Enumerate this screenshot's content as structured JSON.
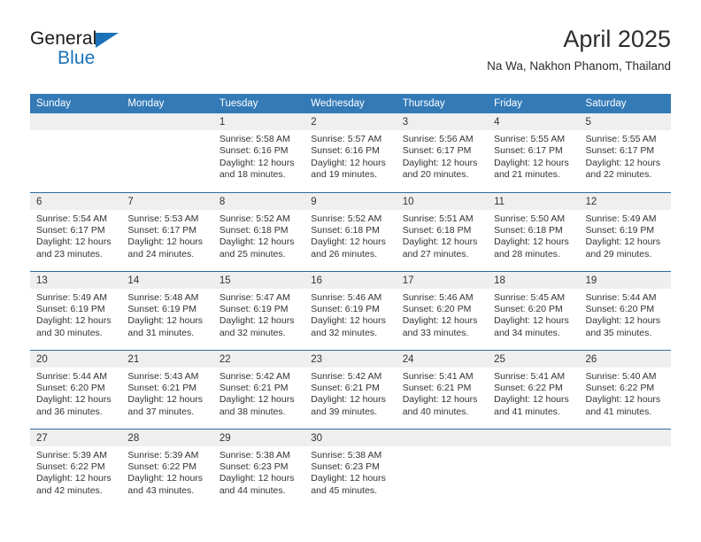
{
  "brand": {
    "name_top": "General",
    "name_bottom": "Blue",
    "accent_color": "#1b72b8"
  },
  "header": {
    "title": "April 2025",
    "subtitle": "Na Wa, Nakhon Phanom, Thailand"
  },
  "theme": {
    "header_blue": "#337ab7",
    "row_rule": "#2b6ca3",
    "daynum_band": "#efefef",
    "text": "#333333"
  },
  "calendar": {
    "weekday_headers": [
      "Sunday",
      "Monday",
      "Tuesday",
      "Wednesday",
      "Thursday",
      "Friday",
      "Saturday"
    ],
    "weeks": [
      [
        {
          "day": "",
          "sunrise": "",
          "sunset": "",
          "daylight_line1": "",
          "daylight_line2": ""
        },
        {
          "day": "",
          "sunrise": "",
          "sunset": "",
          "daylight_line1": "",
          "daylight_line2": ""
        },
        {
          "day": "1",
          "sunrise": "Sunrise: 5:58 AM",
          "sunset": "Sunset: 6:16 PM",
          "daylight_line1": "Daylight: 12 hours",
          "daylight_line2": "and 18 minutes."
        },
        {
          "day": "2",
          "sunrise": "Sunrise: 5:57 AM",
          "sunset": "Sunset: 6:16 PM",
          "daylight_line1": "Daylight: 12 hours",
          "daylight_line2": "and 19 minutes."
        },
        {
          "day": "3",
          "sunrise": "Sunrise: 5:56 AM",
          "sunset": "Sunset: 6:17 PM",
          "daylight_line1": "Daylight: 12 hours",
          "daylight_line2": "and 20 minutes."
        },
        {
          "day": "4",
          "sunrise": "Sunrise: 5:55 AM",
          "sunset": "Sunset: 6:17 PM",
          "daylight_line1": "Daylight: 12 hours",
          "daylight_line2": "and 21 minutes."
        },
        {
          "day": "5",
          "sunrise": "Sunrise: 5:55 AM",
          "sunset": "Sunset: 6:17 PM",
          "daylight_line1": "Daylight: 12 hours",
          "daylight_line2": "and 22 minutes."
        }
      ],
      [
        {
          "day": "6",
          "sunrise": "Sunrise: 5:54 AM",
          "sunset": "Sunset: 6:17 PM",
          "daylight_line1": "Daylight: 12 hours",
          "daylight_line2": "and 23 minutes."
        },
        {
          "day": "7",
          "sunrise": "Sunrise: 5:53 AM",
          "sunset": "Sunset: 6:17 PM",
          "daylight_line1": "Daylight: 12 hours",
          "daylight_line2": "and 24 minutes."
        },
        {
          "day": "8",
          "sunrise": "Sunrise: 5:52 AM",
          "sunset": "Sunset: 6:18 PM",
          "daylight_line1": "Daylight: 12 hours",
          "daylight_line2": "and 25 minutes."
        },
        {
          "day": "9",
          "sunrise": "Sunrise: 5:52 AM",
          "sunset": "Sunset: 6:18 PM",
          "daylight_line1": "Daylight: 12 hours",
          "daylight_line2": "and 26 minutes."
        },
        {
          "day": "10",
          "sunrise": "Sunrise: 5:51 AM",
          "sunset": "Sunset: 6:18 PM",
          "daylight_line1": "Daylight: 12 hours",
          "daylight_line2": "and 27 minutes."
        },
        {
          "day": "11",
          "sunrise": "Sunrise: 5:50 AM",
          "sunset": "Sunset: 6:18 PM",
          "daylight_line1": "Daylight: 12 hours",
          "daylight_line2": "and 28 minutes."
        },
        {
          "day": "12",
          "sunrise": "Sunrise: 5:49 AM",
          "sunset": "Sunset: 6:19 PM",
          "daylight_line1": "Daylight: 12 hours",
          "daylight_line2": "and 29 minutes."
        }
      ],
      [
        {
          "day": "13",
          "sunrise": "Sunrise: 5:49 AM",
          "sunset": "Sunset: 6:19 PM",
          "daylight_line1": "Daylight: 12 hours",
          "daylight_line2": "and 30 minutes."
        },
        {
          "day": "14",
          "sunrise": "Sunrise: 5:48 AM",
          "sunset": "Sunset: 6:19 PM",
          "daylight_line1": "Daylight: 12 hours",
          "daylight_line2": "and 31 minutes."
        },
        {
          "day": "15",
          "sunrise": "Sunrise: 5:47 AM",
          "sunset": "Sunset: 6:19 PM",
          "daylight_line1": "Daylight: 12 hours",
          "daylight_line2": "and 32 minutes."
        },
        {
          "day": "16",
          "sunrise": "Sunrise: 5:46 AM",
          "sunset": "Sunset: 6:19 PM",
          "daylight_line1": "Daylight: 12 hours",
          "daylight_line2": "and 32 minutes."
        },
        {
          "day": "17",
          "sunrise": "Sunrise: 5:46 AM",
          "sunset": "Sunset: 6:20 PM",
          "daylight_line1": "Daylight: 12 hours",
          "daylight_line2": "and 33 minutes."
        },
        {
          "day": "18",
          "sunrise": "Sunrise: 5:45 AM",
          "sunset": "Sunset: 6:20 PM",
          "daylight_line1": "Daylight: 12 hours",
          "daylight_line2": "and 34 minutes."
        },
        {
          "day": "19",
          "sunrise": "Sunrise: 5:44 AM",
          "sunset": "Sunset: 6:20 PM",
          "daylight_line1": "Daylight: 12 hours",
          "daylight_line2": "and 35 minutes."
        }
      ],
      [
        {
          "day": "20",
          "sunrise": "Sunrise: 5:44 AM",
          "sunset": "Sunset: 6:20 PM",
          "daylight_line1": "Daylight: 12 hours",
          "daylight_line2": "and 36 minutes."
        },
        {
          "day": "21",
          "sunrise": "Sunrise: 5:43 AM",
          "sunset": "Sunset: 6:21 PM",
          "daylight_line1": "Daylight: 12 hours",
          "daylight_line2": "and 37 minutes."
        },
        {
          "day": "22",
          "sunrise": "Sunrise: 5:42 AM",
          "sunset": "Sunset: 6:21 PM",
          "daylight_line1": "Daylight: 12 hours",
          "daylight_line2": "and 38 minutes."
        },
        {
          "day": "23",
          "sunrise": "Sunrise: 5:42 AM",
          "sunset": "Sunset: 6:21 PM",
          "daylight_line1": "Daylight: 12 hours",
          "daylight_line2": "and 39 minutes."
        },
        {
          "day": "24",
          "sunrise": "Sunrise: 5:41 AM",
          "sunset": "Sunset: 6:21 PM",
          "daylight_line1": "Daylight: 12 hours",
          "daylight_line2": "and 40 minutes."
        },
        {
          "day": "25",
          "sunrise": "Sunrise: 5:41 AM",
          "sunset": "Sunset: 6:22 PM",
          "daylight_line1": "Daylight: 12 hours",
          "daylight_line2": "and 41 minutes."
        },
        {
          "day": "26",
          "sunrise": "Sunrise: 5:40 AM",
          "sunset": "Sunset: 6:22 PM",
          "daylight_line1": "Daylight: 12 hours",
          "daylight_line2": "and 41 minutes."
        }
      ],
      [
        {
          "day": "27",
          "sunrise": "Sunrise: 5:39 AM",
          "sunset": "Sunset: 6:22 PM",
          "daylight_line1": "Daylight: 12 hours",
          "daylight_line2": "and 42 minutes."
        },
        {
          "day": "28",
          "sunrise": "Sunrise: 5:39 AM",
          "sunset": "Sunset: 6:22 PM",
          "daylight_line1": "Daylight: 12 hours",
          "daylight_line2": "and 43 minutes."
        },
        {
          "day": "29",
          "sunrise": "Sunrise: 5:38 AM",
          "sunset": "Sunset: 6:23 PM",
          "daylight_line1": "Daylight: 12 hours",
          "daylight_line2": "and 44 minutes."
        },
        {
          "day": "30",
          "sunrise": "Sunrise: 5:38 AM",
          "sunset": "Sunset: 6:23 PM",
          "daylight_line1": "Daylight: 12 hours",
          "daylight_line2": "and 45 minutes."
        },
        {
          "day": "",
          "sunrise": "",
          "sunset": "",
          "daylight_line1": "",
          "daylight_line2": ""
        },
        {
          "day": "",
          "sunrise": "",
          "sunset": "",
          "daylight_line1": "",
          "daylight_line2": ""
        },
        {
          "day": "",
          "sunrise": "",
          "sunset": "",
          "daylight_line1": "",
          "daylight_line2": ""
        }
      ]
    ]
  }
}
